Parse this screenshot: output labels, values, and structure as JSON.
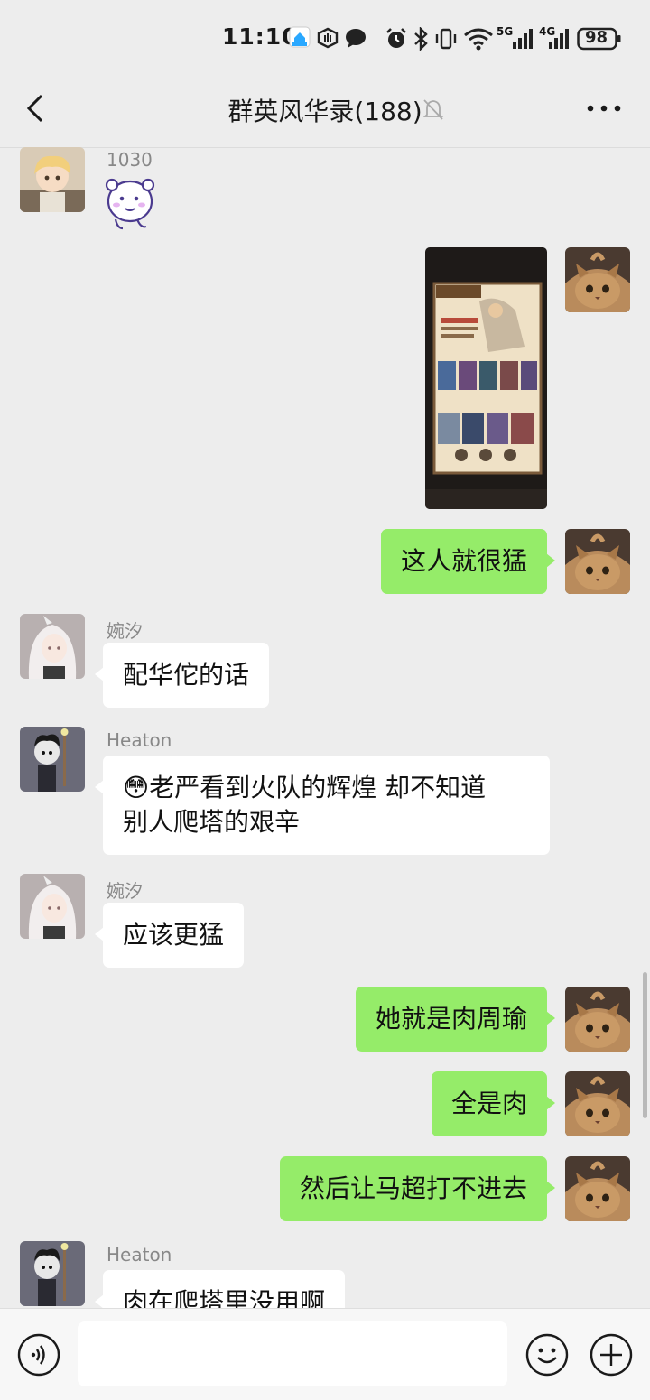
{
  "status_bar": {
    "time": "11:10",
    "battery": "98",
    "network_5g": "5G",
    "network_4g": "4G",
    "icons": [
      "app-notification-icon",
      "hand-icon",
      "chat-bubble-icon",
      "alarm-icon",
      "bluetooth-icon",
      "vibrate-icon",
      "wifi-icon",
      "signal-5g-icon",
      "signal-4g-icon",
      "battery-icon"
    ]
  },
  "header": {
    "title": "群英风华录(188)",
    "icons": [
      "back-arrow-icon",
      "mute-bell-icon",
      "more-dots-icon"
    ]
  },
  "messages": [
    {
      "sender": "1030",
      "direction": "in",
      "type": "sticker",
      "avatar": "anime-boy-avatar"
    },
    {
      "direction": "out",
      "type": "image",
      "avatar": "cat-avatar",
      "image_desc": "game-screenshot"
    },
    {
      "direction": "out",
      "type": "text",
      "text": "这人就很猛",
      "avatar": "cat-avatar"
    },
    {
      "sender": "婉汐",
      "direction": "in",
      "type": "text",
      "text": "配华佗的话",
      "avatar": "white-hair-girl-avatar"
    },
    {
      "sender": "Heaton",
      "direction": "in",
      "type": "text",
      "text_line1": "😳老严看到火队的辉煌 却不知道",
      "text_line2": "别人爬塔的艰辛",
      "avatar": "dark-character-avatar"
    },
    {
      "sender": "婉汐",
      "direction": "in",
      "type": "text",
      "text": "应该更猛",
      "avatar": "white-hair-girl-avatar"
    },
    {
      "direction": "out",
      "type": "text",
      "text": "她就是肉周瑜",
      "avatar": "cat-avatar"
    },
    {
      "direction": "out",
      "type": "text",
      "text": "全是肉",
      "avatar": "cat-avatar"
    },
    {
      "direction": "out",
      "type": "text",
      "text": "然后让马超打不进去",
      "avatar": "cat-avatar"
    },
    {
      "sender": "Heaton",
      "direction": "in",
      "type": "text",
      "text": "肉在爬塔里没用啊",
      "avatar": "dark-character-avatar"
    }
  ],
  "bottom_bar": {
    "input_value": "",
    "icons": [
      "voice-icon",
      "emoji-icon",
      "plus-icon"
    ]
  },
  "colors": {
    "background": "#ededed",
    "outgoing_bubble": "#95ec69",
    "incoming_bubble": "#ffffff",
    "name_text": "#888888"
  }
}
